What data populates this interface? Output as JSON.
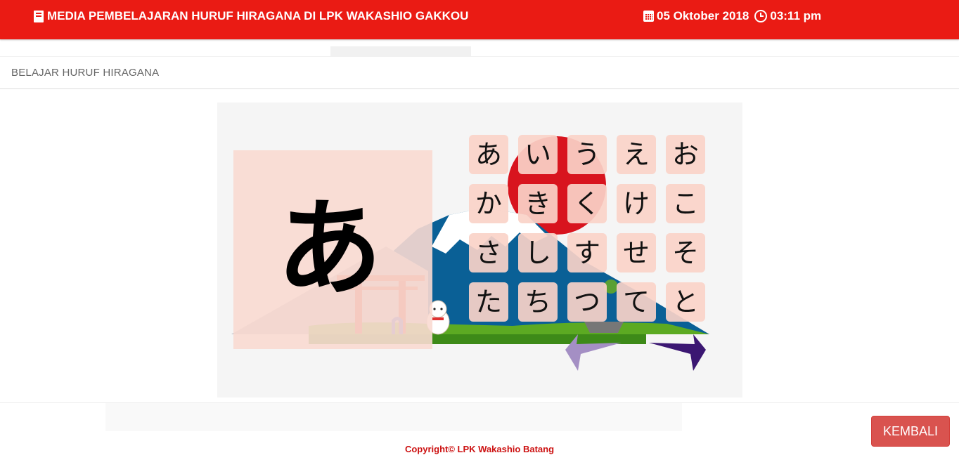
{
  "header": {
    "title": "MEDIA PEMBELAJARAN HURUF HIRAGANA DI LPK WAKASHIO GAKKOU",
    "date": "05 Oktober 2018",
    "time": "03:11 pm",
    "icons": {
      "title": "book-icon",
      "date": "calendar-icon",
      "time": "clock-icon"
    }
  },
  "panel": {
    "heading": "BELAJAR HURUF HIRAGANA"
  },
  "lesson": {
    "selected": "あ",
    "kana": [
      "あ",
      "い",
      "う",
      "え",
      "お",
      "か",
      "き",
      "く",
      "け",
      "こ",
      "さ",
      "し",
      "す",
      "せ",
      "そ",
      "た",
      "ち",
      "つ",
      "て",
      "と"
    ],
    "prev_icon": "arrow-left-icon",
    "next_icon": "arrow-right-icon"
  },
  "actions": {
    "back_label": "KEMBALI"
  },
  "footer": {
    "copyright": "Copyright© LPK Wakashio Batang"
  },
  "colors": {
    "header_bg": "#ea1b14",
    "back_button": "#d9534f",
    "footer_text": "#cc1111",
    "card_bg": "#fadad2"
  }
}
